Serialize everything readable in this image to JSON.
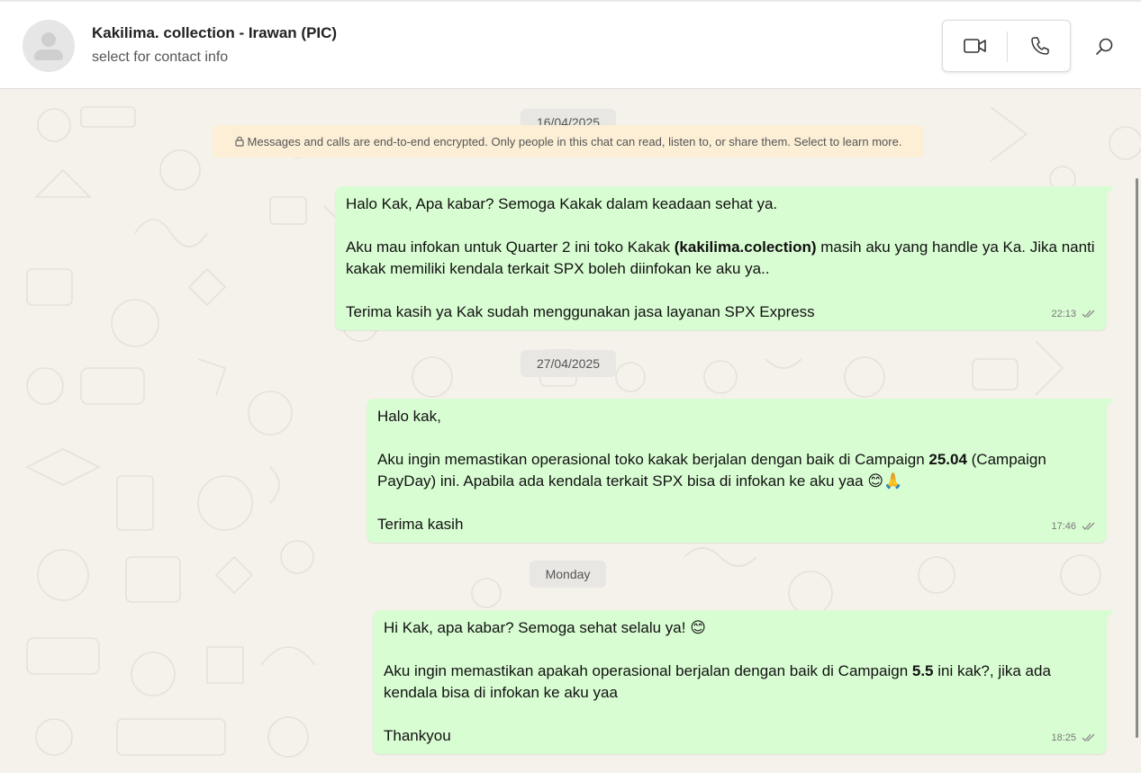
{
  "header": {
    "contact_name": "Kakilima. collection - Irawan (PIC)",
    "contact_subtitle": "select for contact info",
    "avatar_icon": "person-silhouette-icon",
    "video_call_icon": "video-camera-icon",
    "voice_call_icon": "phone-icon",
    "search_icon": "search-icon"
  },
  "chat": {
    "encryption_notice": "Messages and calls are end-to-end encrypted. Only people in this chat can read, listen to, or share them. Select to learn more.",
    "dates": [
      "16/04/2025",
      "27/04/2025",
      "Monday"
    ],
    "messages": [
      {
        "line1": "Halo Kak, Apa kabar? Semoga Kakak dalam keadaan sehat ya.",
        "line2a": "Aku mau infokan untuk Quarter 2 ini toko Kakak ",
        "line2b": "(kakilima.colection)",
        "line2c": " masih aku yang handle ya Ka. Jika nanti kakak memiliki kendala terkait SPX boleh diinfokan ke aku ya..",
        "line3": "Terima kasih ya Kak sudah menggunakan jasa layanan SPX Express",
        "time": "22:13",
        "status": "read"
      },
      {
        "line1": "Halo kak,",
        "line2a": "Aku ingin memastikan operasional toko kakak berjalan dengan baik di Campaign ",
        "line2b": "25.04",
        "line2c": " (Campaign PayDay) ini. Apabila ada kendala terkait SPX bisa di infokan ke aku yaa 😊🙏",
        "line3": "Terima kasih",
        "time": "17:46",
        "status": "read"
      },
      {
        "line1": "Hi Kak, apa kabar? Semoga sehat selalu ya! 😊",
        "line2a": "Aku ingin memastikan apakah operasional berjalan dengan baik di Campaign ",
        "line2b": "5.5",
        "line2c": " ini kak?, jika ada kendala bisa di infokan ke aku yaa",
        "line3": "Thankyou",
        "time": "18:25",
        "status": "read"
      }
    ]
  },
  "colors": {
    "outgoing_bubble": "#d9fdd3",
    "chat_background": "#f5f1eb",
    "encryption_notice_bg": "#fcefd6",
    "date_pill_bg": "#e9e7e3"
  }
}
